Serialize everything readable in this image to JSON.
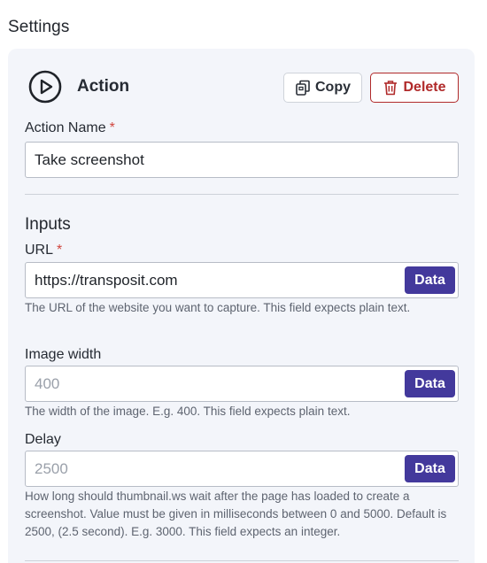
{
  "page": {
    "title": "Settings"
  },
  "action": {
    "title": "Action",
    "icon": "play-circle-icon",
    "copy_label": "Copy",
    "delete_label": "Delete",
    "name_label": "Action Name",
    "name_value": "Take screenshot",
    "required_mark": "*"
  },
  "inputs": {
    "section_title": "Inputs",
    "data_label": "Data",
    "url": {
      "label": "URL",
      "value": "https://transposit.com",
      "help": "The URL of the website you want to capture. This field expects plain text."
    },
    "image_width": {
      "label": "Image width",
      "placeholder": "400",
      "help": "The width of the image. E.g. 400. This field expects plain text."
    },
    "delay": {
      "label": "Delay",
      "placeholder": "2500",
      "help": "How long should thumbnail.ws wait after the page has loaded to create a screenshot. Value must be given in milliseconds between 0 and 5000. Default is 2500, (2.5 second). E.g. 3000. This field expects an integer."
    }
  },
  "colors": {
    "accent": "#43399c",
    "danger": "#b02a2a",
    "panel_bg": "#f3f5fa",
    "required": "#d0463e"
  }
}
